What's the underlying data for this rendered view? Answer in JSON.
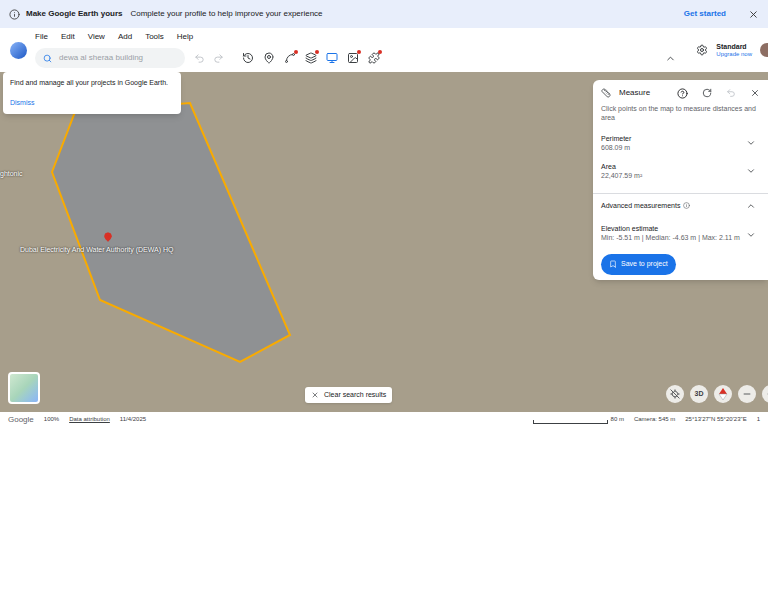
{
  "banner": {
    "title": "Make Google Earth yours",
    "message": "Complete your profile to help improve your experience",
    "action": "Get started"
  },
  "menu": [
    "File",
    "Edit",
    "View",
    "Add",
    "Tools",
    "Help"
  ],
  "search": {
    "query": "dewa al sheraa building"
  },
  "history_buttons": [
    {
      "disabled": true
    },
    {
      "disabled": true
    }
  ],
  "tools": [
    {
      "badge": false
    },
    {
      "badge": false
    },
    {
      "badge": true
    },
    {
      "badge": true
    },
    {
      "badge": false
    },
    {
      "badge": true
    },
    {
      "badge": true
    }
  ],
  "account": {
    "plan": "Standard",
    "upgrade": "Upgrade now"
  },
  "popover": {
    "text": "Find and manage all your projects in Google Earth.",
    "dismiss": "Dismiss"
  },
  "map": {
    "place_label": "Dubai Electricity And Water Authority (DEWA) HQ",
    "edge_label": "ghtonic",
    "clear_search": "Clear search results",
    "view_button": "3D"
  },
  "measure": {
    "title": "Measure",
    "hint": "Click points on the map to measure distances and area",
    "results": [
      {
        "label": "Perimeter",
        "value": "608.09 m",
        "expanded": false
      },
      {
        "label": "Area",
        "value": "22,407.59 m²",
        "expanded": false
      }
    ],
    "advanced": {
      "title": "Advanced measurements",
      "expanded": true,
      "label": "Elevation estimate",
      "value": "Min: -5.51 m | Median: -4.63 m | Max: 2.11 m",
      "value_expanded": false
    },
    "save": "Save to project"
  },
  "status_bar": {
    "brand": "Google",
    "zoom": "100%",
    "attribution": "Data attribution",
    "date": "11/4/2025",
    "scale": "80 m",
    "camera": "Camera: 545 m",
    "coords": "25°13'27\"N 55°20'23\"E",
    "extra": "1"
  }
}
